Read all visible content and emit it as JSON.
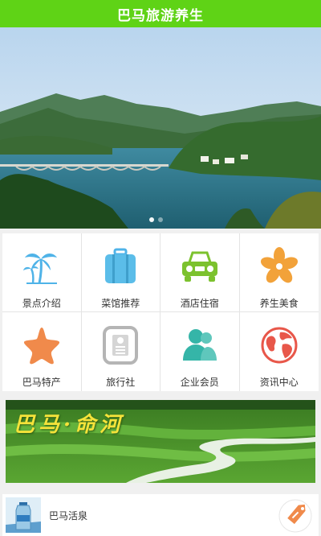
{
  "app": {
    "title": "巴马旅游养生"
  },
  "banner": {
    "slides": 2,
    "active_slide": 1
  },
  "menu": [
    {
      "label": "景点介绍",
      "icon": "palm-tree-icon",
      "color": "#4fb3e8"
    },
    {
      "label": "菜馆推荐",
      "icon": "luggage-icon",
      "color": "#4fb3e8"
    },
    {
      "label": "酒店住宿",
      "icon": "car-icon",
      "color": "#7cc22e"
    },
    {
      "label": "养生美食",
      "icon": "flower-icon",
      "color": "#f2a23a"
    },
    {
      "label": "巴马特产",
      "icon": "star-icon",
      "color": "#f08a4b"
    },
    {
      "label": "旅行社",
      "icon": "contact-card-icon",
      "color": "#b5b5b5"
    },
    {
      "label": "企业会员",
      "icon": "members-icon",
      "color": "#35b5a8"
    },
    {
      "label": "资讯中心",
      "icon": "globe-icon",
      "color": "#e8574a"
    }
  ],
  "feature": {
    "caption": "巴马·命河"
  },
  "product": {
    "name": "巴马活泉",
    "icon": "price-tag-icon",
    "tag_color": "#f08a4b"
  },
  "colors": {
    "header": "#5fd316",
    "background": "#f0f0f0"
  }
}
